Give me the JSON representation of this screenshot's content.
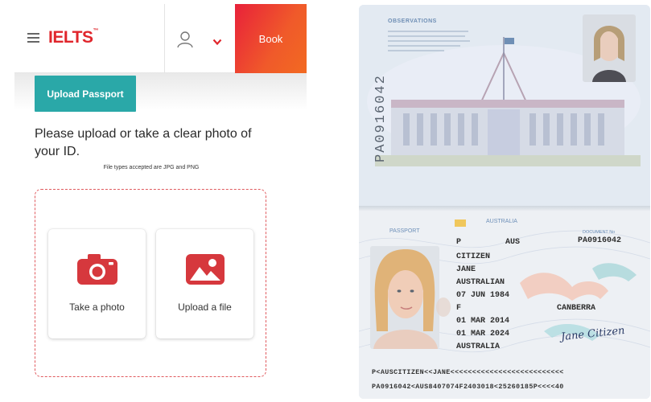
{
  "header": {
    "logo": "IELTS",
    "logo_mark": "™",
    "book_label": "Book"
  },
  "upload": {
    "passport_button": "Upload Passport",
    "instructions": "Please upload or take a clear photo of your ID.",
    "file_types": "File types accepted are JPG and PNG",
    "options": [
      {
        "label": "Take a photo",
        "icon": "camera-icon"
      },
      {
        "label": "Upload a file",
        "icon": "image-icon"
      }
    ]
  },
  "colors": {
    "brand_red": "#e0262c",
    "book_gradient_start": "#e8213a",
    "book_gradient_end": "#f26a21",
    "teal": "#2aa8a8",
    "dropzone_border": "#e05a5e"
  },
  "passport": {
    "observations_title": "OBSERVATIONS",
    "vertical_number": "PA0916042",
    "header_left": "PASSPORT",
    "country": "AUSTRALIA",
    "document_label": "DOCUMENT No",
    "document_no": "PA0916042",
    "type": "P",
    "code": "AUS",
    "surname": "CITIZEN",
    "given_names": "JANE",
    "nationality": "AUSTRALIAN",
    "date_of_birth": "07 JUN 1984",
    "sex": "F",
    "place_of_birth": "CANBERRA",
    "date_of_issue": "01 MAR 2014",
    "date_of_expiry": "01 MAR 2024",
    "authority": "AUSTRALIA",
    "signature": "Jane Citizen",
    "mrz_line1": "P<AUSCITIZEN<<JANE<<<<<<<<<<<<<<<<<<<<<<<<<<",
    "mrz_line2": "PA0916042<AUS8407074F2403018<25260185P<<<<40"
  }
}
